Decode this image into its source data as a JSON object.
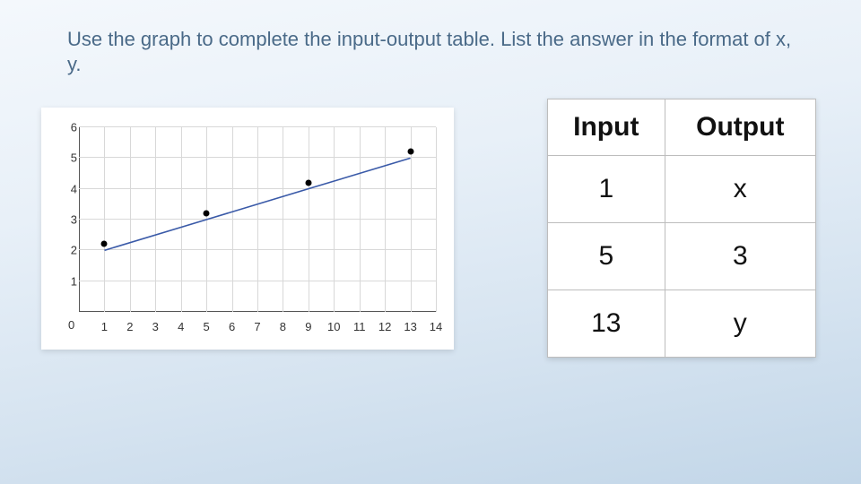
{
  "instruction": "Use the graph to complete the input-output table. List the answer in the format of x, y.",
  "chart_data": {
    "type": "line",
    "title": "",
    "xlabel": "",
    "ylabel": "",
    "xlim": [
      0,
      14
    ],
    "ylim": [
      0,
      6
    ],
    "x_ticks": [
      0,
      1,
      2,
      3,
      4,
      5,
      6,
      7,
      8,
      9,
      10,
      11,
      12,
      13,
      14
    ],
    "y_ticks": [
      0,
      1,
      2,
      3,
      4,
      5,
      6
    ],
    "grid": true,
    "series": [
      {
        "name": "line",
        "x": [
          1,
          5,
          9,
          13
        ],
        "y": [
          2,
          3,
          4,
          5
        ]
      }
    ]
  },
  "table": {
    "headers": {
      "input": "Input",
      "output": "Output"
    },
    "rows": [
      {
        "input": "1",
        "output": "x"
      },
      {
        "input": "5",
        "output": "3"
      },
      {
        "input": "13",
        "output": "y"
      }
    ]
  },
  "axis_labels": {
    "y": {
      "0": "0",
      "1": "1",
      "2": "2",
      "3": "3",
      "4": "4",
      "5": "5",
      "6": "6"
    },
    "x": {
      "0": "0",
      "1": "1",
      "2": "2",
      "3": "3",
      "4": "4",
      "5": "5",
      "6": "6",
      "7": "7",
      "8": "8",
      "9": "9",
      "10": "10",
      "11": "11",
      "12": "12",
      "13": "13",
      "14": "14"
    }
  }
}
